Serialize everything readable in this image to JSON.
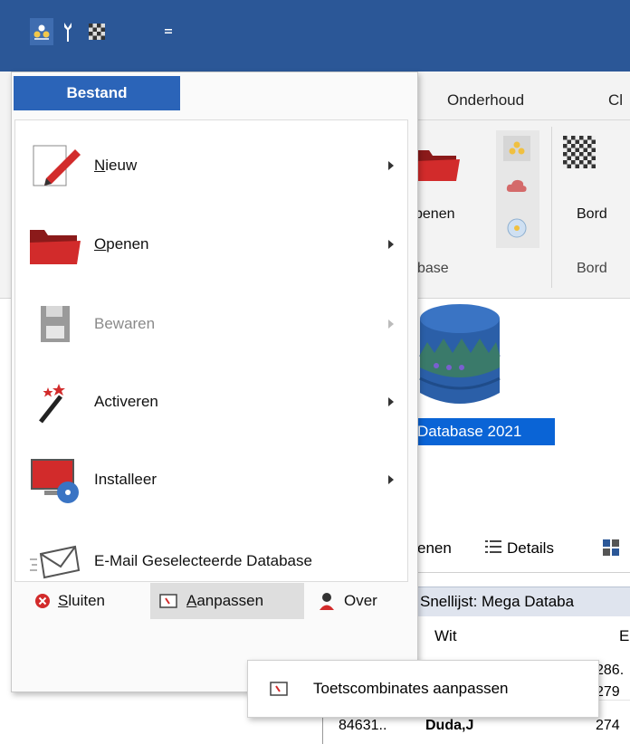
{
  "ribbon": {
    "tabs": [
      "Onderhoud",
      "Cl"
    ],
    "open_label": "penen",
    "board_label": "Bord",
    "group_database": "base",
    "group_board": "Bord"
  },
  "content": {
    "database_label": "Database 2021",
    "toolbar": {
      "open": "enen",
      "details": "Details"
    },
    "quicklist": "Snellijst: Mega Databa",
    "columns": {
      "white": "Wit",
      "elo": "Elo"
    },
    "rows": [
      {
        "id": "",
        "white": "",
        "elo": "286."
      },
      {
        "id": "",
        "white": "",
        "elo": "279"
      },
      {
        "id": "84631..",
        "white": "Duda,J",
        "elo": "274"
      }
    ]
  },
  "menu": {
    "tab": "Bestand",
    "items": [
      {
        "label": "Nieuw",
        "mnemonic": "N",
        "rest": "ieuw",
        "submenu": true,
        "enabled": true
      },
      {
        "label": "Openen",
        "mnemonic": "O",
        "rest": "penen",
        "submenu": true,
        "enabled": true
      },
      {
        "label": "Bewaren",
        "submenu": true,
        "enabled": false
      },
      {
        "label": "Activeren",
        "submenu": true,
        "enabled": true
      },
      {
        "label": "Installeer",
        "submenu": true,
        "enabled": true
      },
      {
        "label": "E-Mail Geselecteerde Database",
        "submenu": false,
        "enabled": true
      }
    ],
    "bottom": {
      "close": {
        "mnemonic": "S",
        "rest": "luiten"
      },
      "customize": {
        "mnemonic": "A",
        "rest": "anpassen"
      },
      "about": "Over"
    }
  },
  "submenu": {
    "item": "Toetscombinates aanpassen"
  }
}
